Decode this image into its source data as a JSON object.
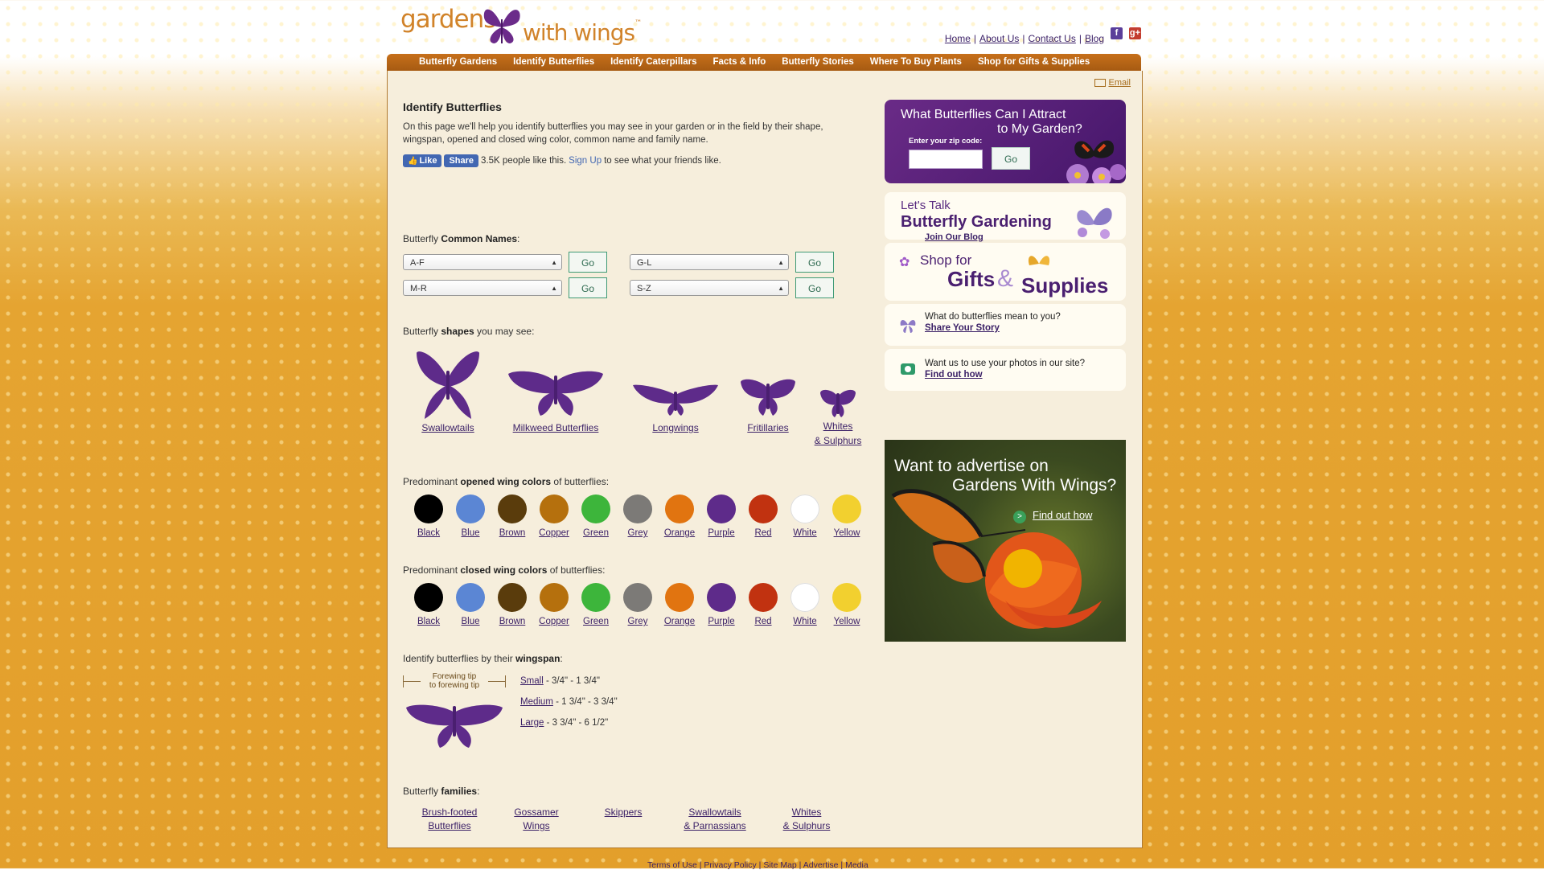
{
  "logo": {
    "word1": "gardens",
    "word2": "with wings",
    "tm": "™"
  },
  "toplinks": [
    {
      "label": "Home"
    },
    {
      "label": "About Us"
    },
    {
      "label": "Contact Us"
    },
    {
      "label": "Blog"
    }
  ],
  "nav": [
    "Butterfly Gardens",
    "Identify Butterflies",
    "Identify Caterpillars",
    "Facts & Info",
    "Butterfly Stories",
    "Where To Buy Plants",
    "Shop for Gifts & Supplies"
  ],
  "email_label": "Email",
  "page": {
    "title": "Identify Butterflies",
    "intro": "On this page we'll help you identify butterflies you may see in your garden or in the field by their shape, wingspan, opened and closed wing color, common name and family name.",
    "like": {
      "like_label": "Like",
      "share_label": "Share",
      "count_text": "3.5K people like this.",
      "signup": "Sign Up",
      "rest": "to see what your friends like."
    }
  },
  "common_names": {
    "prefix": "Butterfly ",
    "bold": "Common Names",
    "suffix": ":",
    "selects": [
      "A-F",
      "G-L",
      "M-R",
      "S-Z"
    ],
    "go_label": "Go"
  },
  "shapes": {
    "prefix": "Butterfly ",
    "bold": "shapes",
    "suffix": " you may see:",
    "items": [
      "Swallowtails",
      "Milkweed Butterflies",
      "Longwings",
      "Fritillaries",
      "Whites",
      "& Sulphurs"
    ]
  },
  "opened_colors": {
    "prefix": "Predominant ",
    "bold": "opened wing colors",
    "suffix": " of butterflies:"
  },
  "closed_colors": {
    "prefix": "Predominant ",
    "bold": "closed wing colors",
    "suffix": " of butterflies:"
  },
  "colors": [
    {
      "name": "Black",
      "hex": "#000000"
    },
    {
      "name": "Blue",
      "hex": "#5b86d4"
    },
    {
      "name": "Brown",
      "hex": "#5a3c0c"
    },
    {
      "name": "Copper",
      "hex": "#b5700d"
    },
    {
      "name": "Green",
      "hex": "#3db53b"
    },
    {
      "name": "Grey",
      "hex": "#7c7a77"
    },
    {
      "name": "Orange",
      "hex": "#e17410"
    },
    {
      "name": "Purple",
      "hex": "#5e2b8a"
    },
    {
      "name": "Red",
      "hex": "#c13210"
    },
    {
      "name": "White",
      "hex": "#ffffff"
    },
    {
      "name": "Yellow",
      "hex": "#f2d02f"
    }
  ],
  "wingspan": {
    "prefix": "Identify butterflies by their ",
    "bold": "wingspan",
    "suffix": ":",
    "diagram_label_1": "Forewing tip",
    "diagram_label_2": "to forewing tip",
    "sizes": [
      {
        "label": "Small",
        "range": " - 3/4\" - 1 3/4\""
      },
      {
        "label": "Medium",
        "range": " - 1 3/4\" - 3 3/4\""
      },
      {
        "label": "Large",
        "range": " - 3 3/4\" - 6 1/2\""
      }
    ]
  },
  "families": {
    "prefix": "Butterfly ",
    "bold": "families",
    "suffix": ":",
    "items": [
      {
        "line1": "Brush-footed",
        "line2": "Butterflies"
      },
      {
        "line1": "Gossamer",
        "line2": "Wings"
      },
      {
        "line1": "Skippers",
        "line2": ""
      },
      {
        "line1": "Swallowtails",
        "line2": "& Parnassians"
      },
      {
        "line1": "Whites",
        "line2": "& Sulphurs"
      }
    ]
  },
  "sidebar": {
    "attract": {
      "line1": "What Butterflies Can I Attract",
      "line2": "to My Garden?",
      "zip_label": "Enter your zip code:",
      "go_label": "Go"
    },
    "blog": {
      "lets_talk": "Let's Talk",
      "title": "Butterfly Gardening",
      "link": "Join Our Blog"
    },
    "shop": {
      "shop_for": "Shop for",
      "gifts": "Gifts",
      "amp": "&",
      "supplies": "Supplies"
    },
    "story": {
      "text": "What do butterflies mean to you?",
      "link": "Share Your Story"
    },
    "photos": {
      "text": "Want us to use your photos in our site?",
      "link": "Find out how"
    },
    "advert": {
      "line1": "Want to advertise on",
      "line2": "Gardens With Wings?",
      "link": "Find out how"
    }
  },
  "footer": {
    "text": "Terms of Use | Privacy Policy | Site Map | Advertise | Media"
  }
}
